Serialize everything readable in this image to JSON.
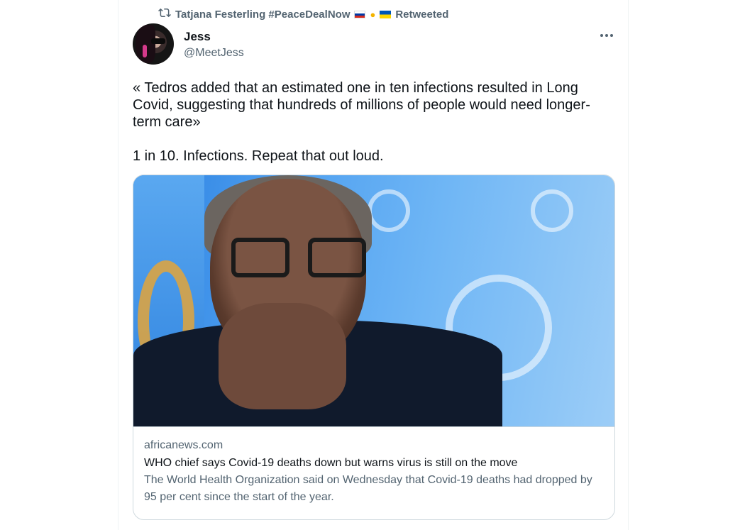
{
  "retweet": {
    "icon": "retweet-icon",
    "retweeter": "Tatjana Festerling #PeaceDealNow",
    "flags": [
      "ru-flag-icon",
      "handshake-icon",
      "ua-flag-icon"
    ],
    "label": "Retweeted"
  },
  "author": {
    "display_name": "Jess",
    "handle": "@MeetJess"
  },
  "tweet": {
    "paragraph_1": "« Tedros added that an estimated one in ten infections resulted in Long Covid, suggesting that hundreds of millions of people would need longer-term care»",
    "paragraph_2": "1 in 10. Infections. Repeat that out loud."
  },
  "link_card": {
    "domain": "africanews.com",
    "title": "WHO chief says Covid-19 deaths down but warns virus is still on the move",
    "description": "The World Health Organization said on Wednesday that Covid-19 deaths had dropped by 95 per cent since the start of the year."
  },
  "colors": {
    "text_primary": "#0f1419",
    "text_secondary": "#536471",
    "border": "#cfd9de"
  }
}
